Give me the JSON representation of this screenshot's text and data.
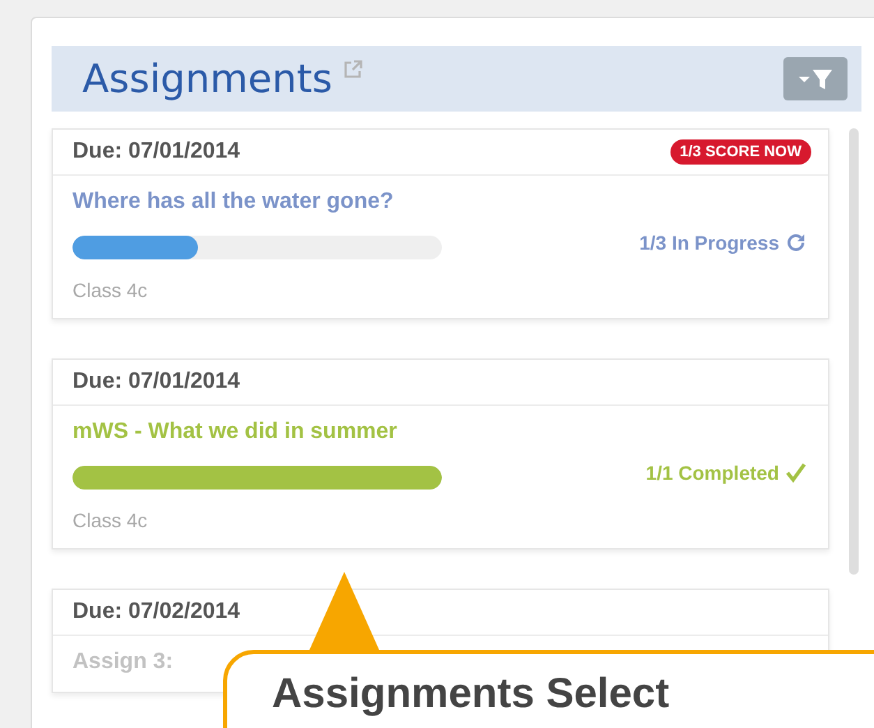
{
  "header": {
    "title": "Assignments"
  },
  "assignments": [
    {
      "due": "Due: 07/01/2014",
      "badge": "1/3 SCORE NOW",
      "title": "Where has all the water gone?",
      "kind": "in_progress",
      "level": 0.34,
      "progress_text": "1/3 In Progress",
      "class_name": "Class 4c"
    },
    {
      "due": "Due: 07/01/2014",
      "title": "mWS - What we did in summer",
      "kind": "completed",
      "level": 1,
      "progress_text": "1/1 Completed",
      "class_name": "Class 4c"
    },
    {
      "due": "Due: 07/02/2014",
      "title": "Assign 3:",
      "kind": "pending"
    }
  ],
  "tooltip": {
    "text": "Assignments Select"
  }
}
